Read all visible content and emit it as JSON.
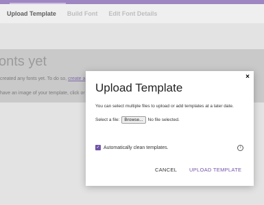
{
  "tabs": [
    {
      "label": "Upload Template",
      "active": true
    },
    {
      "label": "Build Font",
      "active": false
    },
    {
      "label": "Edit Font Details",
      "active": false
    }
  ],
  "background": {
    "heading": "onts yet",
    "line1_text": "created any fonts yet. To do so,",
    "line1_link": "create a",
    "line2_text": "have an image of your template, click or"
  },
  "modal": {
    "close_label": "×",
    "title": "Upload Template",
    "description": "You can select multiple files to upload or add templates at a later date.",
    "file_label": "Select a file:",
    "browse_label": "Browse...",
    "file_status": "No file selected.",
    "auto_clean_label": "Automatically clean templates.",
    "auto_clean_checked": true,
    "info_symbol": "i",
    "cancel_label": "CANCEL",
    "upload_label": "UPLOAD TEMPLATE"
  },
  "colors": {
    "accent": "#6f52a8",
    "topbar": "#9e86c2"
  }
}
